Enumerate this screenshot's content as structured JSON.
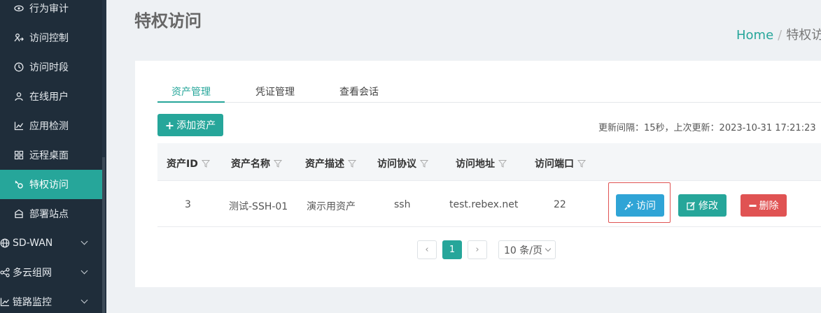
{
  "sidebar": {
    "items": [
      {
        "label": "行为审计",
        "icon": "eye-icon"
      },
      {
        "label": "访问控制",
        "icon": "access-control-icon"
      },
      {
        "label": "访问时段",
        "icon": "clock-icon"
      },
      {
        "label": "在线用户",
        "icon": "user-icon"
      },
      {
        "label": "应用检测",
        "icon": "line-chart-icon"
      },
      {
        "label": "远程桌面",
        "icon": "grid-icon"
      },
      {
        "label": "特权访问",
        "icon": "key-icon",
        "active": true
      },
      {
        "label": "部署站点",
        "icon": "site-icon"
      }
    ],
    "groups": [
      {
        "label": "SD-WAN",
        "icon": "globe-icon"
      },
      {
        "label": "多云组网",
        "icon": "cloud-network-icon"
      },
      {
        "label": "链路监控",
        "icon": "trend-icon"
      }
    ]
  },
  "header": {
    "title": "特权访问",
    "breadcrumb": {
      "home": "Home",
      "separator": "/",
      "current": "特权访问"
    }
  },
  "tabs": [
    {
      "label": "资产管理",
      "active": true
    },
    {
      "label": "凭证管理"
    },
    {
      "label": "查看会话"
    }
  ],
  "toolbar": {
    "add_label": "添加资产",
    "refresh_info": "更新间隔：15秒，上次更新：2023-10-31 17:21:23"
  },
  "table": {
    "columns": [
      "资产ID",
      "资产名称",
      "资产描述",
      "访问协议",
      "访问地址",
      "访问端口"
    ],
    "rows": [
      {
        "id": "3",
        "name": "测试-SSH-01",
        "desc": "演示用资产",
        "protocol": "ssh",
        "address": "test.rebex.net",
        "port": "22"
      }
    ],
    "actions": {
      "visit": "访问",
      "edit": "修改",
      "delete": "删除"
    }
  },
  "pagination": {
    "current": "1",
    "page_size": "10 条/页"
  },
  "colors": {
    "accent": "#26a69a",
    "visit": "#2fa4d6",
    "danger": "#e05353",
    "sidebar_bg": "#1f2d3a"
  }
}
